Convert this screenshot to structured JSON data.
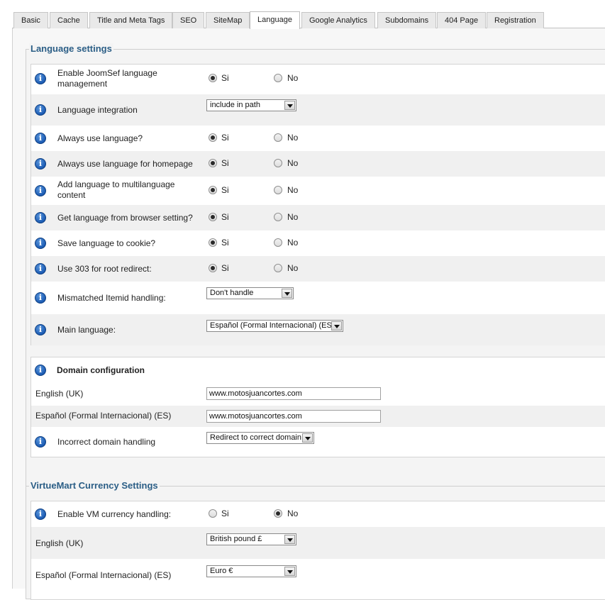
{
  "tabs": [
    "Basic",
    "Cache",
    "Title and Meta Tags",
    "SEO",
    "SiteMap",
    "Language",
    "Google Analytics",
    "Subdomains",
    "404 Page",
    "Registration"
  ],
  "active_tab": "Language",
  "radio": {
    "yes": "Si",
    "no": "No"
  },
  "language_settings": {
    "legend": "Language settings",
    "rows": [
      {
        "label": "Enable JoomSef language management",
        "value": "Si"
      },
      {
        "label": "Language integration",
        "value": "include in path"
      },
      {
        "label": "Always use language?",
        "value": "Si"
      },
      {
        "label": "Always use language for homepage",
        "value": "Si"
      },
      {
        "label": "Add language to multilanguage content",
        "value": "Si"
      },
      {
        "label": "Get language from browser setting?",
        "value": "Si"
      },
      {
        "label": "Save language to cookie?",
        "value": "Si"
      },
      {
        "label": "Use 303 for root redirect:",
        "value": "Si"
      },
      {
        "label": "Mismatched Itemid handling:",
        "value": "Don't handle"
      },
      {
        "label": "Main language:",
        "value": "Español (Formal Internacional) (ES)"
      }
    ]
  },
  "domain_config": {
    "title": "Domain configuration",
    "rows": [
      {
        "label": "English (UK)",
        "value": "www.motosjuancortes.com"
      },
      {
        "label": "Español (Formal Internacional) (ES)",
        "value": "www.motosjuancortes.com"
      },
      {
        "label": "Incorrect domain handling",
        "value": "Redirect to correct domain"
      }
    ]
  },
  "currency": {
    "legend": "VirtueMart Currency Settings",
    "rows": [
      {
        "label": "Enable VM currency handling:",
        "value": "No"
      },
      {
        "label": "English (UK)",
        "value": "British pound £"
      },
      {
        "label": "Español (Formal Internacional) (ES)",
        "value": "Euro €"
      }
    ]
  }
}
